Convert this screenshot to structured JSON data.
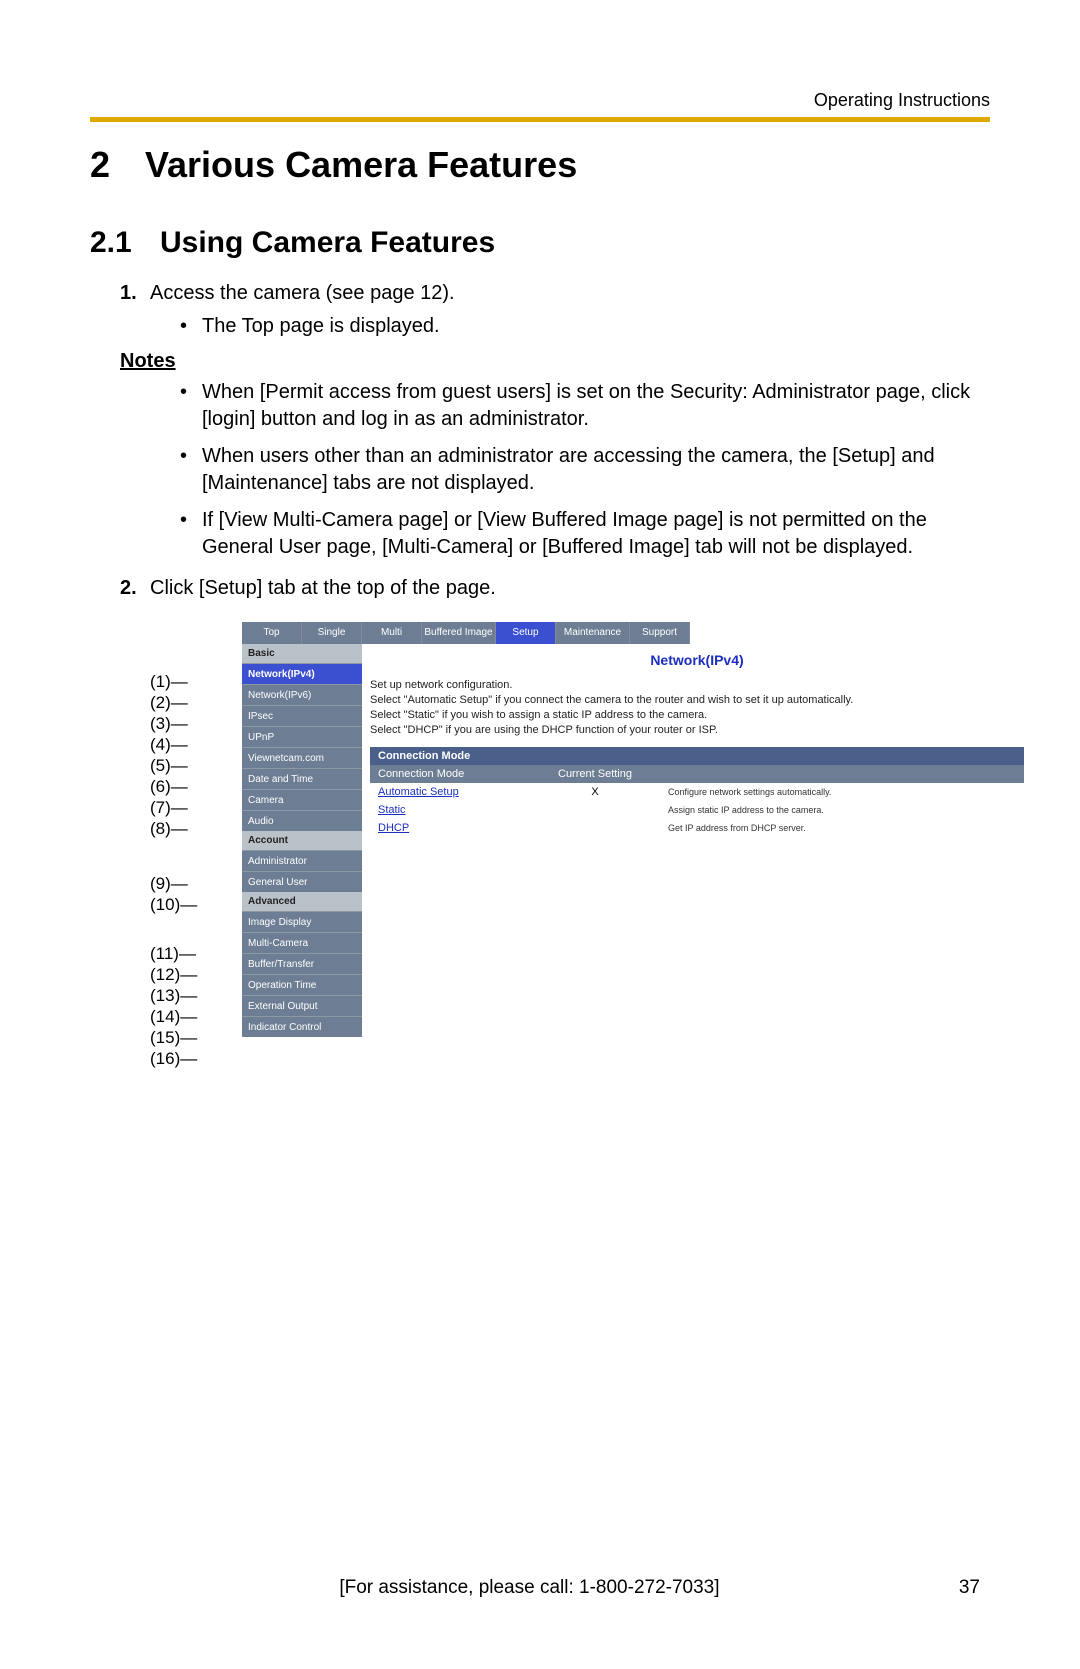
{
  "header": {
    "running": "Operating Instructions"
  },
  "chapter": {
    "num": "2",
    "title": "Various Camera Features"
  },
  "section": {
    "num": "2.1",
    "title": "Using Camera Features"
  },
  "steps": {
    "s1_num": "1.",
    "s1_text": "Access the camera (see page 12).",
    "s1_sub1": "The Top page is displayed.",
    "s2_num": "2.",
    "s2_text": "Click [Setup] tab at the top of the page."
  },
  "notes_hd": "Notes",
  "notes": {
    "n1": "When [Permit access from guest users] is set on the Security: Administrator page, click [login] button and log in as an administrator.",
    "n2": "When users other than an administrator are accessing the camera, the [Setup] and [Maintenance] tabs are not displayed.",
    "n3": "If [View Multi-Camera page] or [View Buffered Image page] is not permitted on the General User page, [Multi-Camera] or [Buffered Image] tab will not be displayed."
  },
  "callouts": {
    "c1": "(1)",
    "c2": "(2)",
    "c3": "(3)",
    "c4": "(4)",
    "c5": "(5)",
    "c6": "(6)",
    "c7": "(7)",
    "c8": "(8)",
    "c9": "(9)",
    "c10": "(10)",
    "c11": "(11)",
    "c12": "(12)",
    "c13": "(13)",
    "c14": "(14)",
    "c15": "(15)",
    "c16": "(16)"
  },
  "shot": {
    "tabs": {
      "top": "Top",
      "single": "Single",
      "multi": "Multi",
      "buffered": "Buffered Image",
      "setup": "Setup",
      "maint": "Maintenance",
      "support": "Support"
    },
    "sidebar": {
      "g_basic": "Basic",
      "i_net4": "Network(IPv4)",
      "i_net6": "Network(IPv6)",
      "i_ipsec": "IPsec",
      "i_upnp": "UPnP",
      "i_viewnet": "Viewnetcam.com",
      "i_datetime": "Date and Time",
      "i_camera": "Camera",
      "i_audio": "Audio",
      "g_account": "Account",
      "i_admin": "Administrator",
      "i_genuser": "General User",
      "g_advanced": "Advanced",
      "i_imgdisp": "Image Display",
      "i_multicam": "Multi-Camera",
      "i_buffer": "Buffer/Transfer",
      "i_optime": "Operation Time",
      "i_extout": "External Output",
      "i_indctrl": "Indicator Control"
    },
    "main": {
      "title": "Network(IPv4)",
      "desc": "Set up network configuration.\nSelect \"Automatic Setup\" if you connect the camera to the router and wish to set it up automatically.\nSelect \"Static\" if you wish to assign a static IP address to the camera.\nSelect \"DHCP\" if you are using the DHCP function of your router or ISP.",
      "panel_hd": "Connection Mode",
      "th_mode": "Connection Mode",
      "th_cur": "Current Setting",
      "row_auto": "Automatic Setup",
      "row_auto_cur": "X",
      "row_auto_note": "Configure network settings automatically.",
      "row_static": "Static",
      "row_static_note": "Assign static IP address to the camera.",
      "row_dhcp": "DHCP",
      "row_dhcp_note": "Get IP address from DHCP server."
    }
  },
  "footer": {
    "assist": "[For assistance, please call: 1-800-272-7033]",
    "page": "37"
  }
}
